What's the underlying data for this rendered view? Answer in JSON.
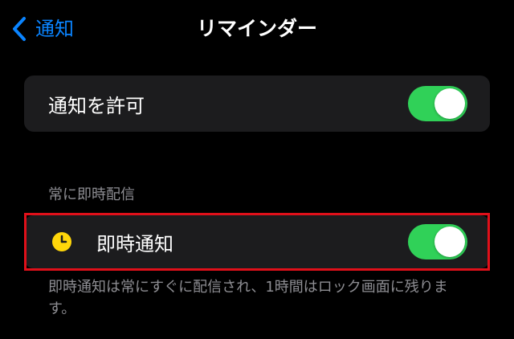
{
  "nav": {
    "back_label": "通知",
    "title": "リマインダー"
  },
  "allow_notifications": {
    "label": "通知を許可",
    "enabled": true
  },
  "section": {
    "header": "常に即時配信",
    "items": [
      {
        "label": "即時通知",
        "icon": "clock-icon",
        "icon_color": "#ffd60a",
        "enabled": true
      }
    ],
    "footer": "即時通知は常にすぐに配信され、1時間はロック画面に残ります。"
  },
  "colors": {
    "accent": "#0a84ff",
    "toggle_on": "#30d158",
    "highlight": "#e0101a",
    "background": "#000000",
    "cell": "#1c1c1e",
    "secondary_text": "#8e8e93"
  }
}
